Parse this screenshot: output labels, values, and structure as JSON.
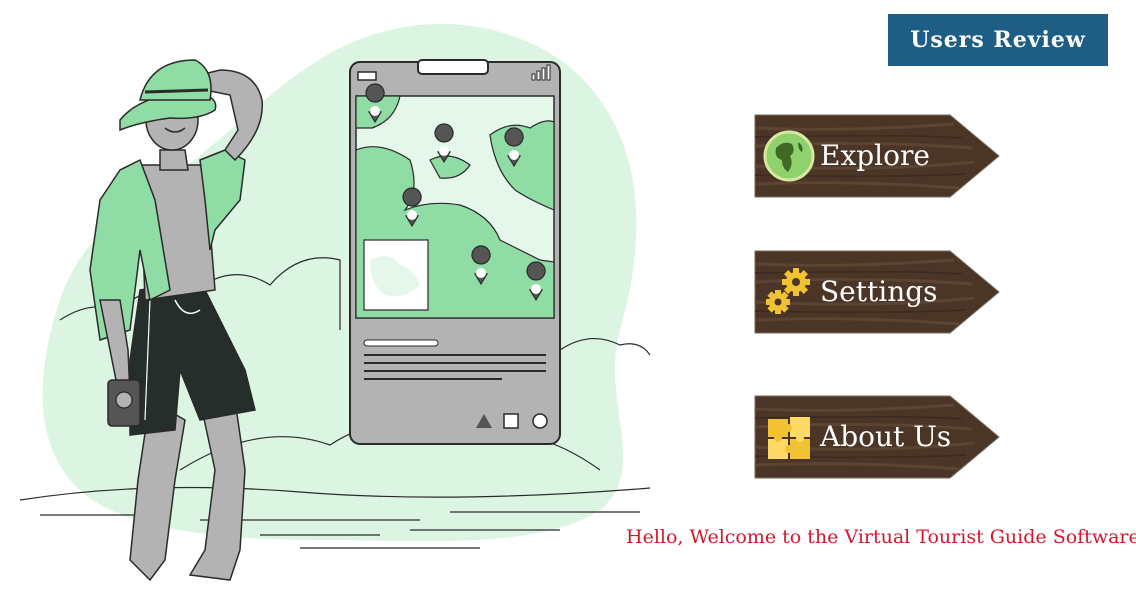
{
  "header": {
    "review_button_label": "Users Review"
  },
  "menu": {
    "items": [
      {
        "label": "Explore",
        "icon": "globe-icon"
      },
      {
        "label": "Settings",
        "icon": "gears-icon"
      },
      {
        "label": "About Us",
        "icon": "puzzle-icon"
      }
    ]
  },
  "footer": {
    "welcome_text": "Hello, Welcome to the Virtual Tourist Guide Software"
  },
  "colors": {
    "review_button_bg": "#1e5e84",
    "sign_wood": "#4a3526",
    "sign_wood_light": "#5c4433",
    "illustration_green": "#8fdca5",
    "illustration_mint": "#dcf5e2",
    "phone_gray": "#b3b3b3",
    "welcome_text": "#d6162f",
    "icon_yellow": "#f1c232"
  }
}
